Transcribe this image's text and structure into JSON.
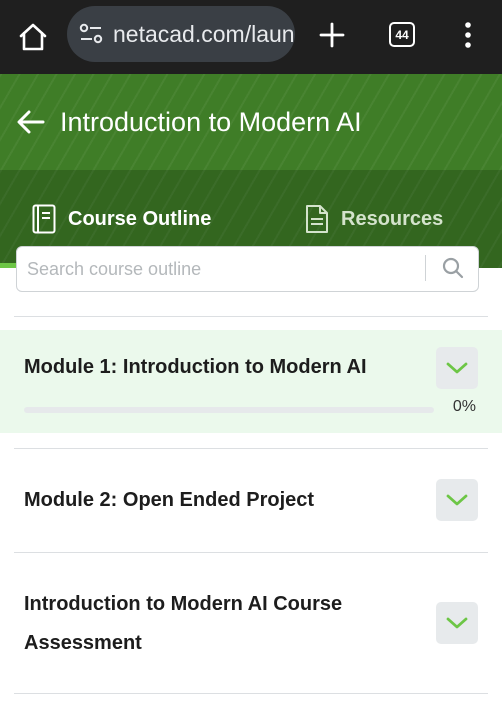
{
  "browser": {
    "url": "netacad.com/laun",
    "tab_count": "44",
    "icons": [
      "home-icon",
      "site-info-icon",
      "plus-icon",
      "tab-switcher-icon",
      "more-vert-icon"
    ]
  },
  "header": {
    "title": "Introduction to Modern AI",
    "back_icon": "arrow-left-icon",
    "tabs": [
      {
        "label": "Course Outline",
        "icon": "book-icon",
        "active": true
      },
      {
        "label": "Resources",
        "icon": "document-icon",
        "active": false
      }
    ]
  },
  "search": {
    "placeholder": "Search course outline",
    "icon": "search-icon"
  },
  "modules": [
    {
      "title": "Module 1: Introduction to Modern AI",
      "progress": 0,
      "progress_label": "0%",
      "highlighted": true
    },
    {
      "title": "Module 2: Open Ended Project"
    },
    {
      "title": "Introduction to Modern AI Course Assessment"
    }
  ],
  "colors": {
    "browser_bar": "#1f1f1f",
    "header_green": "#3f7d27",
    "accent_green": "#6dc646",
    "module_highlight": "#ebf9ec",
    "chevron": "#6dc646"
  }
}
